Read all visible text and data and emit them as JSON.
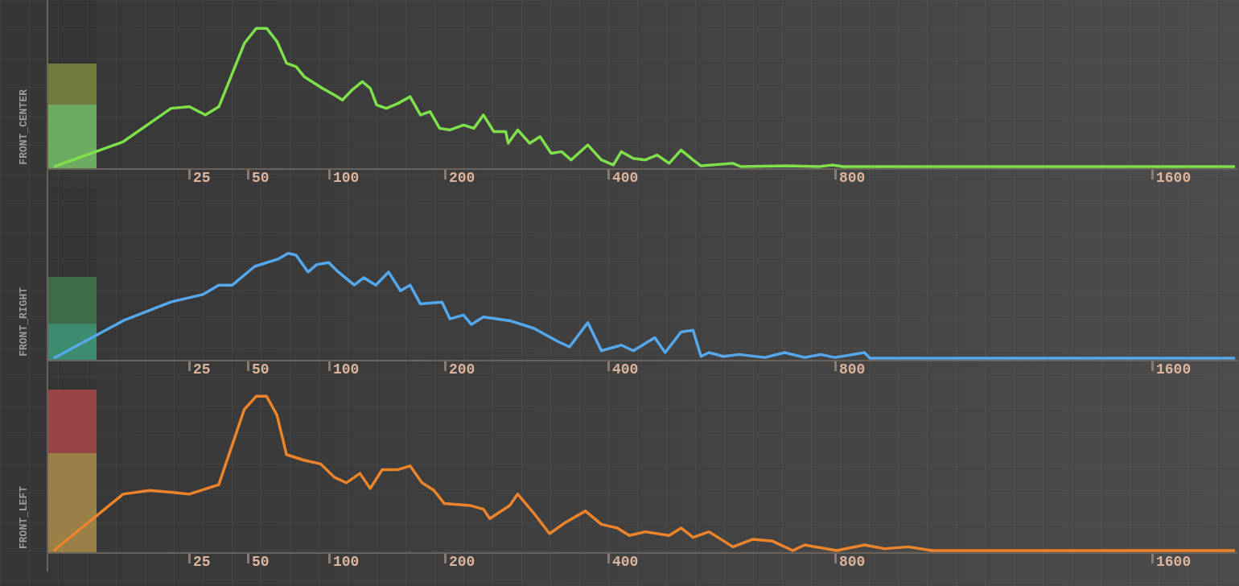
{
  "channels": [
    {
      "label": "FRONT_CENTER",
      "color": "#7ee04a",
      "meter": [
        {
          "kind": "peak",
          "level": 0.62
        },
        {
          "kind": "rms",
          "level": 0.38
        }
      ],
      "ticks": [
        "25",
        "50",
        "100",
        "200",
        "400",
        "800",
        "1600"
      ]
    },
    {
      "label": "FRONT_RIGHT",
      "color": "#55a8ec",
      "meter": [
        {
          "kind": "peak",
          "level": 0.48
        },
        {
          "kind": "rms",
          "level": 0.21
        }
      ],
      "ticks": [
        "25",
        "50",
        "100",
        "200",
        "400",
        "800",
        "1600"
      ]
    },
    {
      "label": "FRONT_LEFT",
      "color": "#ec842c",
      "meter": [
        {
          "kind": "peak",
          "level": 0.94
        },
        {
          "kind": "rms",
          "level": 0.57
        }
      ],
      "ticks": [
        "25",
        "50",
        "100",
        "200",
        "400",
        "800",
        "1600"
      ]
    }
  ]
}
